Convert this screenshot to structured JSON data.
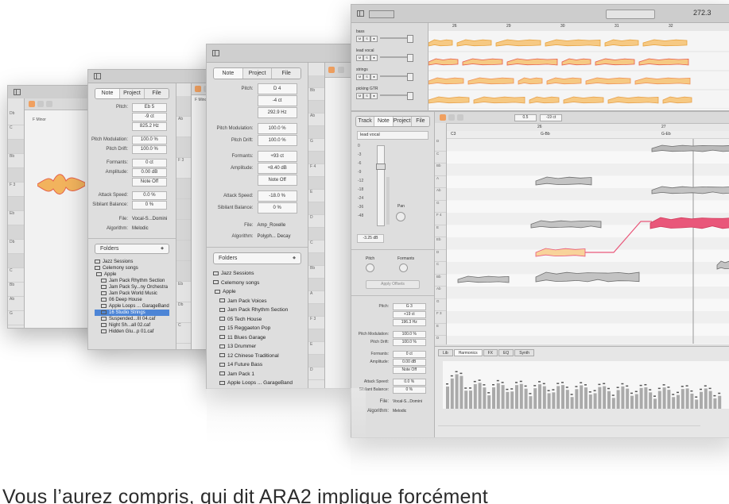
{
  "w1": {
    "editor_labels": [
      "F Minor",
      "b"
    ],
    "key_labels": [
      "Db",
      "C",
      "",
      "Bb",
      "",
      "F 3",
      "",
      "Eb",
      "",
      "Db",
      "",
      "C",
      "Bb",
      "Ab",
      "G"
    ]
  },
  "w2": {
    "tabs": [
      "Note",
      "Project",
      "File"
    ],
    "params": [
      {
        "label": "Pitch:",
        "value": "Eb 5"
      },
      {
        "label": "",
        "value": "-9 ct"
      },
      {
        "label": "",
        "value": "825.2 Hz"
      },
      {
        "label": "Pitch Modulation:",
        "value": "100.0 %"
      },
      {
        "label": "Pitch Drift:",
        "value": "100.0 %"
      },
      {
        "label": "Formants:",
        "value": "0 ct"
      },
      {
        "label": "Amplitude:",
        "value": "0.00 dB"
      },
      {
        "label": "",
        "value": "Note Off"
      },
      {
        "label": "Attack Speed:",
        "value": "0.0 %"
      },
      {
        "label": "Sibilant Balance:",
        "value": "0 %"
      }
    ],
    "file_label": "File:",
    "file_value": "Vocal-S...Domini",
    "algo_label": "Algorithm:",
    "algo_value": "Melodic",
    "folder_select": "Folders",
    "folders": [
      "Jazz Sessions",
      "Celemony songs",
      "Apple",
      "Jam Pack Rhythm Section",
      "Jam Pack Sy...ny Orchestra",
      "Jam Pack World Music",
      "06 Deep House",
      "Apple Loops ... GarageBand",
      "16 Studio Strings",
      "Suspended...III 04.caf",
      "Night Sh...all 02.caf",
      "Hidden Glu...p 01.caf"
    ],
    "editor_labels": [
      "F Minor",
      "b"
    ],
    "key_labels": [
      "",
      "Ab",
      "",
      "F 3",
      "",
      "",
      "",
      "",
      "",
      "Eb",
      "Db",
      "C"
    ]
  },
  "w3": {
    "tabs": [
      "Note",
      "Project",
      "File"
    ],
    "params": [
      {
        "label": "Pitch:",
        "value": "D 4"
      },
      {
        "label": "",
        "value": "-4 ct"
      },
      {
        "label": "",
        "value": "292.9 Hz"
      },
      {
        "label": "Pitch Modulation:",
        "value": "100.0 %"
      },
      {
        "label": "Pitch Drift:",
        "value": "100.0 %"
      },
      {
        "label": "Formants:",
        "value": "+93 ct"
      },
      {
        "label": "Amplitude:",
        "value": "+8.40 dB"
      },
      {
        "label": "",
        "value": "Note Off"
      },
      {
        "label": "Attack Speed:",
        "value": "-18.0 %"
      },
      {
        "label": "Sibilant Balance:",
        "value": "0 %"
      }
    ],
    "file_label": "File:",
    "file_value": "Amp_Roxelle",
    "algo_label": "Algorithm:",
    "algo_value": "Polyph... Decay",
    "folder_select": "Folders",
    "folders": [
      "Jazz Sessions",
      "Celemony songs",
      "Apple",
      "Jam Pack Voices",
      "Jam Pack Rhythm Section",
      "05 Tech House",
      "15 Reggaeton Pop",
      "11 Blues Garage",
      "13 Drummer",
      "12 Chinese Traditional",
      "14 Future Bass",
      "Jam Pack 1",
      "Apple Loops ... GarageBand"
    ],
    "key_labels": [
      "",
      "Bb",
      "",
      "Ab",
      "",
      "G",
      "",
      "F 4",
      "",
      "E",
      "",
      "D",
      "",
      "C",
      "",
      "Bb",
      "",
      "A",
      "",
      "F 3",
      "",
      "E",
      "",
      "D"
    ]
  },
  "w4": {
    "tempo": "272.3",
    "ruler": [
      "26",
      "29",
      "30",
      "31",
      "32"
    ],
    "tracks": [
      {
        "name": "bass",
        "color": "#e8a23c"
      },
      {
        "name": "lead vocal",
        "color": "#e75a4c"
      },
      {
        "name": "strings",
        "color": "#ef8f55"
      },
      {
        "name": "picking GTR",
        "color": "#e7a04a"
      }
    ],
    "left_tabs": [
      "Track",
      "Note",
      "Project",
      "File"
    ],
    "track_name": "lead vocal",
    "db_scale": [
      "0",
      "-3",
      "-6",
      "-9",
      "-12",
      "-18",
      "-24",
      "-36",
      "-48"
    ],
    "pan_label": "Pan",
    "level": "-3.25 dB",
    "fmt_label": "Pitch",
    "fmt_label2": "Formants",
    "apply_label": "Apply Offsets",
    "note_params": [
      {
        "label": "Pitch:",
        "value": "G 3"
      },
      {
        "label": "",
        "value": "+19 ct"
      },
      {
        "label": "",
        "value": "196.3 Hz"
      },
      {
        "label": "Pitch Modulation:",
        "value": "100.0 %"
      },
      {
        "label": "Pitch Drift:",
        "value": "100.0 %"
      },
      {
        "label": "Formants:",
        "value": "0 ct"
      },
      {
        "label": "Amplitude:",
        "value": "0.00 dB"
      },
      {
        "label": "",
        "value": "Note Off"
      },
      {
        "label": "Attack Speed:",
        "value": "0.0 %"
      },
      {
        "label": "Sibilant Balance:",
        "value": "0 %"
      }
    ],
    "file_label": "File:",
    "file_value": "Vocal-S...Domini",
    "algo_label": "Algorithm:",
    "algo_value": "Melodic",
    "toolbar_fields": [
      "0.5",
      "-19 ct"
    ],
    "editor_ruler": [
      "26",
      "27"
    ],
    "chord_labels": [
      "C3",
      "G-Bb",
      "G-Eb"
    ],
    "key_labels": [
      "D",
      "C",
      "Bb",
      "A",
      "Ab",
      "G",
      "F 4",
      "E",
      "Eb",
      "D",
      "C",
      "Bb",
      "Ab",
      "G",
      "F 3",
      "E",
      "D"
    ],
    "bottom_tabs": [
      "Lib",
      "Harmonics",
      "FX",
      "EQ",
      "Synth"
    ]
  },
  "caption": "Vous l’aurez compris, qui dit ARA2 implique forcément"
}
